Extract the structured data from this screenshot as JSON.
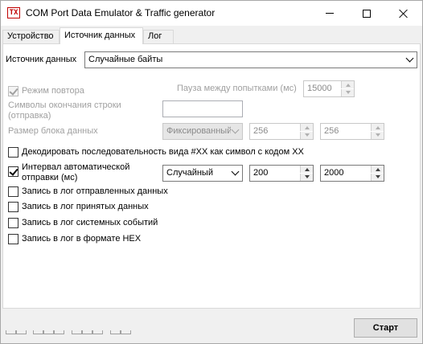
{
  "window": {
    "icon_text": "TX",
    "title": "COM Port Data Emulator & Traffic generator"
  },
  "tabs": [
    {
      "label": "Устройство"
    },
    {
      "label": "Источник данных"
    },
    {
      "label": "Лог"
    }
  ],
  "source": {
    "label": "Источник данных",
    "value": "Случайные байты"
  },
  "repeat": {
    "label": "Режим повтора",
    "checked": true,
    "pause_label": "Пауза между попытками (мс)",
    "pause_value": "15000"
  },
  "eol": {
    "label_line1": "Символы окончания строки",
    "label_line2": "(отправка)",
    "value": ""
  },
  "block": {
    "label": "Размер блока данных",
    "mode": "Фиксированный",
    "min": "256",
    "max": "256"
  },
  "decode": {
    "label": "Декодировать последовательность вида #XX как символ с кодом XX",
    "checked": false
  },
  "interval": {
    "label_line1": "Интервал автоматической",
    "label_line2": "отправки (мс)",
    "checked": true,
    "mode": "Случайный",
    "min": "200",
    "max": "2000"
  },
  "logs": [
    {
      "label": "Запись в лог отправленных данных",
      "checked": false
    },
    {
      "label": "Запись в лог принятых данных",
      "checked": false
    },
    {
      "label": "Запись в лог системных событий",
      "checked": false
    },
    {
      "label": "Запись в лог в формате HEX",
      "checked": false
    }
  ],
  "start_button": "Старт",
  "icons": [
    "app-icon",
    "minimize-icon",
    "maximize-icon",
    "close-icon",
    "checkbox-check-icon",
    "chevron-down-icon",
    "spin-up-icon",
    "spin-down-icon"
  ]
}
